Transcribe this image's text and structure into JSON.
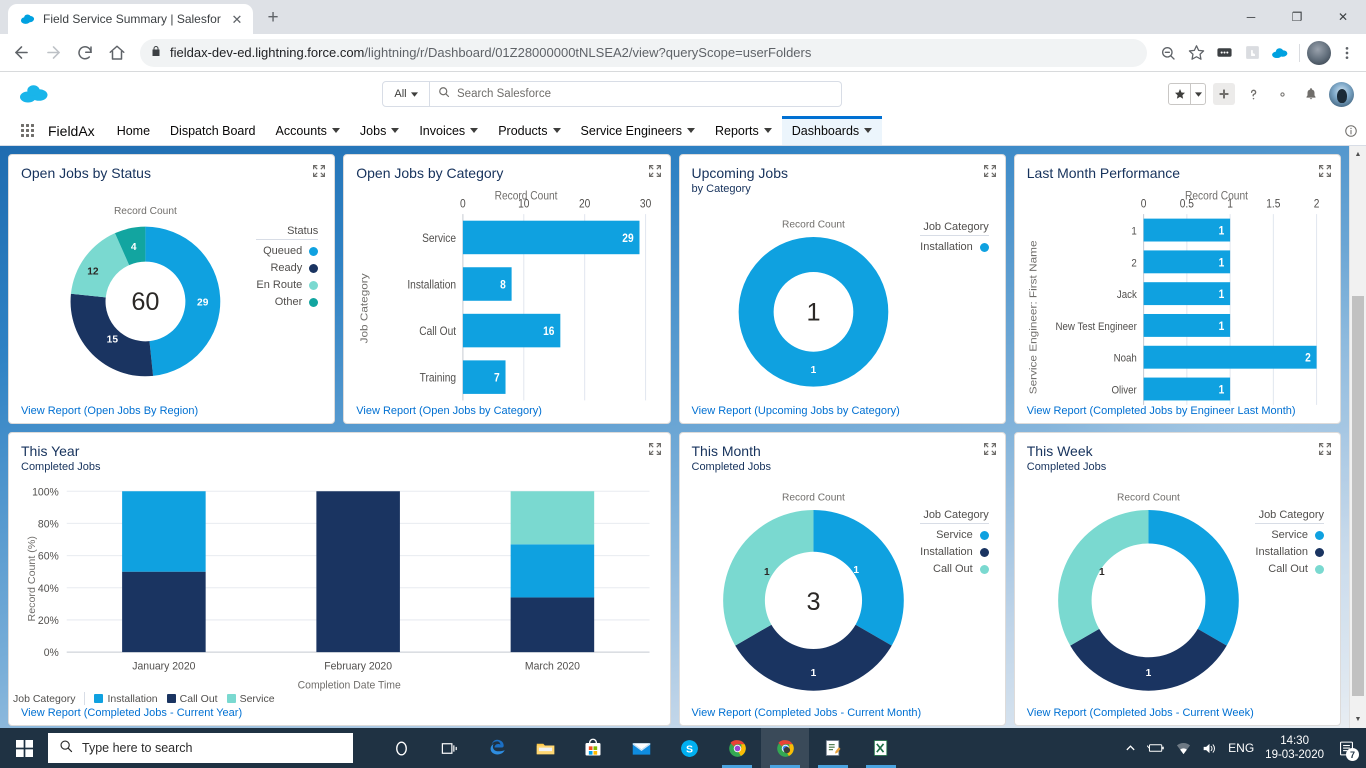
{
  "browser": {
    "tab_title": "Field Service Summary | Salesforce",
    "new_tab_label": "+",
    "close_label": "✕",
    "minimize_label": "─",
    "maximize_label": "❐",
    "win_close_label": "✕",
    "url": "fieldax-dev-ed.lightning.force.com",
    "url_path": "/lightning/r/Dashboard/01Z28000000tNLSEA2/view?queryScope=userFolders",
    "icons": {
      "back": "back-arrow-icon",
      "forward": "forward-arrow-icon",
      "reload": "reload-icon",
      "home": "home-icon",
      "lock": "lock-icon",
      "zoom_out": "zoom-out-icon",
      "bookmark": "star-icon",
      "extension1": "extension-icon",
      "extension2": "hand-extension-icon",
      "extension3": "salesforce-extension-icon",
      "menu": "three-dot-menu-icon"
    }
  },
  "salesforce": {
    "search_scope": "All",
    "search_placeholder": "Search Salesforce",
    "app_name": "FieldAx",
    "nav": [
      {
        "label": "Home",
        "has_menu": false,
        "active": false
      },
      {
        "label": "Dispatch Board",
        "has_menu": false,
        "active": false
      },
      {
        "label": "Accounts",
        "has_menu": true,
        "active": false
      },
      {
        "label": "Jobs",
        "has_menu": true,
        "active": false
      },
      {
        "label": "Invoices",
        "has_menu": true,
        "active": false
      },
      {
        "label": "Products",
        "has_menu": true,
        "active": false
      },
      {
        "label": "Service Engineers",
        "has_menu": true,
        "active": false
      },
      {
        "label": "Reports",
        "has_menu": true,
        "active": false
      },
      {
        "label": "Dashboards",
        "has_menu": true,
        "active": true
      }
    ],
    "header_icons": [
      "favorites-star-icon",
      "favorites-dropdown-icon",
      "add-icon",
      "help-icon",
      "setup-gear-icon",
      "notifications-bell-icon",
      "user-avatar"
    ]
  },
  "colors": {
    "light_blue": "#0fa1e0",
    "navy": "#1a3461",
    "mint": "#7ad9d0",
    "teal": "#12a5a0",
    "link": "#0070d2",
    "title": "#16325c"
  },
  "cards": [
    {
      "title": "Open Jobs by Status",
      "subtitle": "",
      "view_report": "View Report (Open Jobs By Region)",
      "expand_icon": "expand-icon"
    },
    {
      "title": "Open Jobs by Category",
      "subtitle": "",
      "view_report": "View Report (Open Jobs by Category)",
      "expand_icon": "expand-icon"
    },
    {
      "title": "Upcoming Jobs",
      "subtitle": "by Category",
      "view_report": "View Report (Upcoming Jobs by Category)",
      "expand_icon": "expand-icon"
    },
    {
      "title": "Last Month Performance",
      "subtitle": "",
      "view_report": "View Report (Completed Jobs by Engineer Last Month)",
      "expand_icon": "expand-icon"
    },
    {
      "title": "This Year",
      "subtitle": "Completed Jobs",
      "view_report": "View Report (Completed Jobs - Current Year)",
      "expand_icon": "expand-icon"
    },
    {
      "title": "This Month",
      "subtitle": "Completed Jobs",
      "view_report": "View Report (Completed Jobs - Current Month)",
      "expand_icon": "expand-icon"
    },
    {
      "title": "This Week",
      "subtitle": "Completed Jobs",
      "view_report": "View Report (Completed Jobs - Current Week)",
      "expand_icon": "expand-icon"
    }
  ],
  "chart_data": [
    {
      "id": "open_jobs_by_status",
      "type": "pie",
      "title": "Open Jobs by Status",
      "measure_label": "Record Count",
      "legend_title": "Status",
      "legend_position": "right",
      "center_total": "60",
      "categories": [
        "Queued",
        "Ready",
        "En Route",
        "Other"
      ],
      "values": [
        29,
        15,
        12,
        4
      ],
      "colors": [
        "#0fa1e0",
        "#1a3461",
        "#7ad9d0",
        "#12a5a0"
      ]
    },
    {
      "id": "open_jobs_by_category",
      "type": "bar",
      "orientation": "horizontal",
      "title": "Open Jobs by Category",
      "xlabel": "Record Count",
      "ylabel": "Job Category",
      "categories": [
        "Service",
        "Installation",
        "Call Out",
        "Training"
      ],
      "values": [
        29,
        8,
        16,
        7
      ],
      "xlim": [
        0,
        30
      ],
      "xticks": [
        "0",
        "10",
        "20",
        "30"
      ],
      "grid": true,
      "color": "#0fa1e0"
    },
    {
      "id": "upcoming_jobs",
      "type": "pie",
      "title": "Upcoming Jobs",
      "subtitle": "by Category",
      "measure_label": "Record Count",
      "legend_title": "Job Category",
      "legend_position": "right",
      "center_total": "1",
      "categories": [
        "Installation"
      ],
      "values": [
        1
      ],
      "colors": [
        "#0fa1e0"
      ]
    },
    {
      "id": "last_month_performance",
      "type": "bar",
      "orientation": "horizontal",
      "title": "Last Month Performance",
      "xlabel": "Record Count",
      "ylabel": "Service Engineer: First Name",
      "categories": [
        "1",
        "2",
        "Jack",
        "New Test Engineer",
        "Noah",
        "Oliver"
      ],
      "values": [
        1,
        1,
        1,
        1,
        2,
        1
      ],
      "xlim": [
        0,
        2
      ],
      "xticks": [
        "0",
        "0.5",
        "1",
        "1.5",
        "2"
      ],
      "grid": true,
      "color": "#0fa1e0"
    },
    {
      "id": "this_year",
      "type": "bar",
      "stacked": true,
      "orientation": "vertical",
      "title": "This Year",
      "subtitle": "Completed Jobs",
      "xlabel": "Completion Date Time",
      "ylabel": "Record Count (%)",
      "categories": [
        "January 2020",
        "February 2020",
        "March 2020"
      ],
      "ylim": [
        0,
        100
      ],
      "yticks": [
        "0%",
        "20%",
        "40%",
        "60%",
        "80%",
        "100%"
      ],
      "legend_title": "Job Category",
      "legend_position": "bottom",
      "series": [
        {
          "name": "Call Out",
          "color": "#1a3461",
          "values": [
            50,
            100,
            34
          ]
        },
        {
          "name": "Installation",
          "color": "#0fa1e0",
          "values": [
            50,
            0,
            33
          ]
        },
        {
          "name": "Service",
          "color": "#7ad9d0",
          "values": [
            0,
            0,
            33
          ]
        }
      ],
      "legend_order": [
        "Installation",
        "Call Out",
        "Service"
      ]
    },
    {
      "id": "this_month",
      "type": "pie",
      "title": "This Month",
      "subtitle": "Completed Jobs",
      "measure_label": "Record Count",
      "legend_title": "Job Category",
      "legend_position": "right",
      "center_total": "3",
      "categories": [
        "Service",
        "Installation",
        "Call Out"
      ],
      "values": [
        1,
        1,
        1
      ],
      "colors": [
        "#0fa1e0",
        "#1a3461",
        "#7ad9d0"
      ]
    },
    {
      "id": "this_week",
      "type": "pie",
      "title": "This Week",
      "subtitle": "Completed Jobs",
      "measure_label": "Record Count",
      "legend_title": "Job Category",
      "legend_position": "right",
      "center_total": "",
      "categories": [
        "Service",
        "Installation",
        "Call Out"
      ],
      "values": [
        1,
        1,
        1
      ],
      "colors": [
        "#0fa1e0",
        "#1a3461",
        "#7ad9d0"
      ]
    }
  ],
  "taskbar": {
    "search_placeholder": "Type here to search",
    "apps": [
      "cortana-icon",
      "task-view-icon",
      "edge-icon",
      "file-explorer-icon",
      "microsoft-store-icon",
      "mail-icon",
      "skype-icon",
      "chrome-canary-icon",
      "chrome-icon",
      "notepad-icon",
      "excel-icon"
    ],
    "language": "ENG",
    "time": "14:30",
    "date": "19-03-2020",
    "notification_count": "7"
  }
}
